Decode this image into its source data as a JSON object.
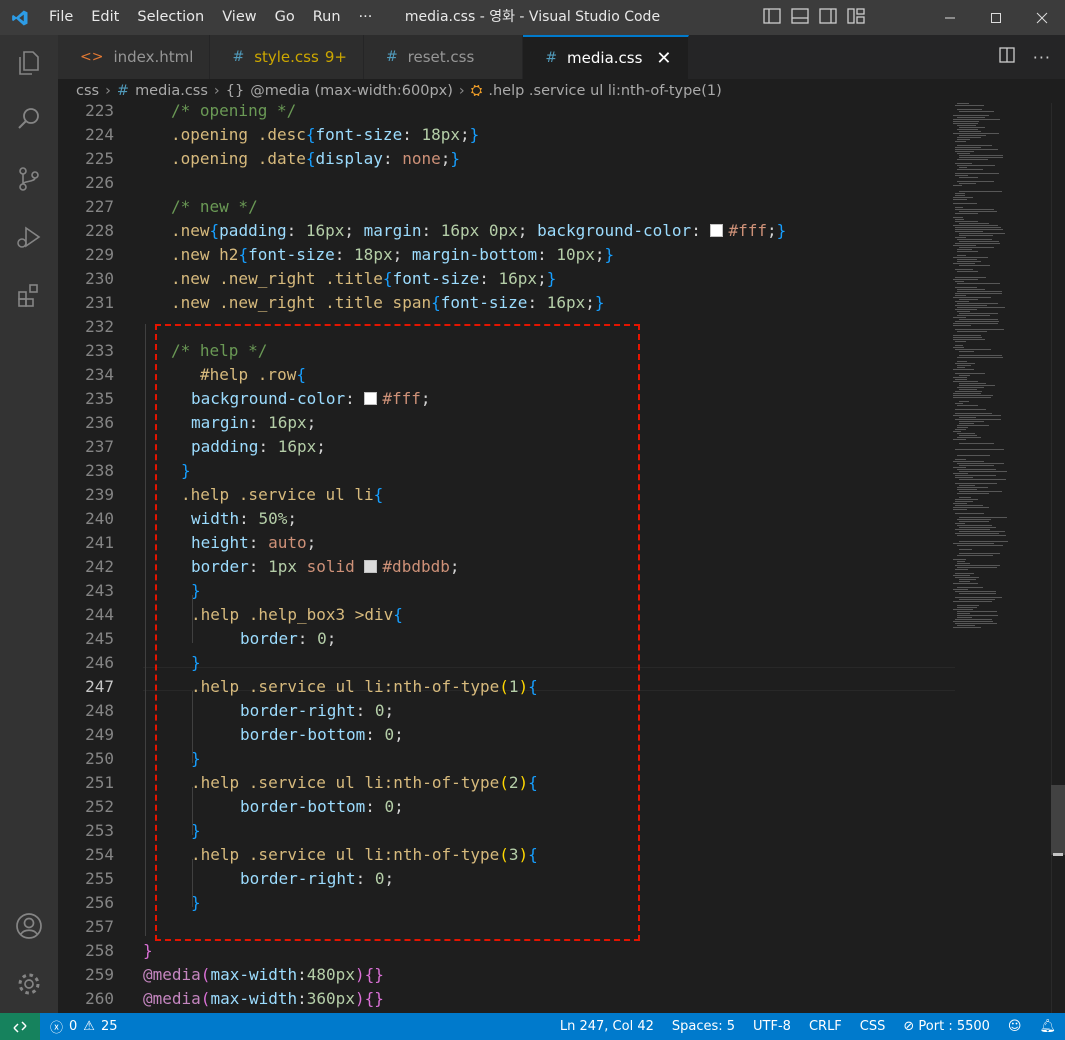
{
  "titlebar": {
    "menu": [
      "File",
      "Edit",
      "Selection",
      "View",
      "Go",
      "Run",
      "···"
    ],
    "title": "media.css - 영화 - Visual Studio Code",
    "accent_color": "#007acc"
  },
  "activitybar": {
    "icons": [
      "explorer-icon",
      "search-icon",
      "source-control-icon",
      "run-debug-icon",
      "extensions-icon",
      "account-icon",
      "settings-gear-icon"
    ]
  },
  "tabs": [
    {
      "icon": "<>",
      "label": "index.html",
      "badge": ""
    },
    {
      "icon": "#",
      "label": "style.css",
      "badge": "9+"
    },
    {
      "icon": "#",
      "label": "reset.css",
      "badge": ""
    },
    {
      "icon": "#",
      "label": "media.css",
      "badge": "",
      "active": true
    }
  ],
  "breadcrumb": {
    "folder": "css",
    "file": "media.css",
    "media": "@media (max-width:600px)",
    "selector": ".help .service ul li:nth-of-type(1)"
  },
  "editor": {
    "current_line": 247,
    "lines": [
      {
        "n": "223",
        "tokens": [
          [
            "t-cm",
            "/* opening */"
          ]
        ],
        "indent": 28
      },
      {
        "n": "224",
        "tokens": [
          [
            "t-sel",
            ".opening .desc"
          ],
          [
            "t-b3",
            "{"
          ],
          [
            "t-prop",
            "font-size"
          ],
          [
            "t-pun",
            ": "
          ],
          [
            "t-num",
            "18px"
          ],
          [
            "t-pun",
            ";"
          ],
          [
            "t-b3",
            "}"
          ]
        ],
        "indent": 28
      },
      {
        "n": "225",
        "tokens": [
          [
            "t-sel",
            ".opening .date"
          ],
          [
            "t-b3",
            "{"
          ],
          [
            "t-prop",
            "display"
          ],
          [
            "t-pun",
            ": "
          ],
          [
            "t-val",
            "none"
          ],
          [
            "t-pun",
            ";"
          ],
          [
            "t-b3",
            "}"
          ]
        ],
        "indent": 28
      },
      {
        "n": "226",
        "tokens": [],
        "indent": 0
      },
      {
        "n": "227",
        "tokens": [
          [
            "t-cm",
            "/* new */"
          ]
        ],
        "indent": 28
      },
      {
        "n": "228",
        "tokens": [
          [
            "t-sel",
            ".new"
          ],
          [
            "t-b3",
            "{"
          ],
          [
            "t-prop",
            "padding"
          ],
          [
            "t-pun",
            ": "
          ],
          [
            "t-num",
            "16px"
          ],
          [
            "t-pun",
            "; "
          ],
          [
            "t-prop",
            "margin"
          ],
          [
            "t-pun",
            ": "
          ],
          [
            "t-num",
            "16px 0px"
          ],
          [
            "t-pun",
            "; "
          ],
          [
            "t-prop",
            "background-color"
          ],
          [
            "t-pun",
            ": "
          ],
          [
            "swatch",
            "#ffffff"
          ],
          [
            "t-val",
            "#fff"
          ],
          [
            "t-pun",
            ";"
          ],
          [
            "t-b3",
            "}"
          ]
        ],
        "indent": 28
      },
      {
        "n": "229",
        "tokens": [
          [
            "t-sel",
            ".new h2"
          ],
          [
            "t-b3",
            "{"
          ],
          [
            "t-prop",
            "font-size"
          ],
          [
            "t-pun",
            ": "
          ],
          [
            "t-num",
            "18px"
          ],
          [
            "t-pun",
            "; "
          ],
          [
            "t-prop",
            "margin-bottom"
          ],
          [
            "t-pun",
            ": "
          ],
          [
            "t-num",
            "10px"
          ],
          [
            "t-pun",
            ";"
          ],
          [
            "t-b3",
            "}"
          ]
        ],
        "indent": 28
      },
      {
        "n": "230",
        "tokens": [
          [
            "t-sel",
            ".new .new_right .title"
          ],
          [
            "t-b3",
            "{"
          ],
          [
            "t-prop",
            "font-size"
          ],
          [
            "t-pun",
            ": "
          ],
          [
            "t-num",
            "16px"
          ],
          [
            "t-pun",
            ";"
          ],
          [
            "t-b3",
            "}"
          ]
        ],
        "indent": 28
      },
      {
        "n": "231",
        "tokens": [
          [
            "t-sel",
            ".new .new_right .title span"
          ],
          [
            "t-b3",
            "{"
          ],
          [
            "t-prop",
            "font-size"
          ],
          [
            "t-pun",
            ": "
          ],
          [
            "t-num",
            "16px"
          ],
          [
            "t-pun",
            ";"
          ],
          [
            "t-b3",
            "}"
          ]
        ],
        "indent": 28
      },
      {
        "n": "232",
        "tokens": [],
        "indent": 0
      },
      {
        "n": "233",
        "tokens": [
          [
            "t-cm",
            "/* help */"
          ]
        ],
        "indent": 28
      },
      {
        "n": "234",
        "tokens": [
          [
            "t-sel",
            "#help .row"
          ],
          [
            "t-b3",
            "{"
          ]
        ],
        "indent": 57
      },
      {
        "n": "235",
        "tokens": [
          [
            "t-prop",
            "background-color"
          ],
          [
            "t-pun",
            ": "
          ],
          [
            "swatch",
            "#ffffff"
          ],
          [
            "t-val",
            "#fff"
          ],
          [
            "t-pun",
            ";"
          ]
        ],
        "indent": 48
      },
      {
        "n": "236",
        "tokens": [
          [
            "t-prop",
            "margin"
          ],
          [
            "t-pun",
            ": "
          ],
          [
            "t-num",
            "16px"
          ],
          [
            "t-pun",
            ";"
          ]
        ],
        "indent": 48
      },
      {
        "n": "237",
        "tokens": [
          [
            "t-prop",
            "padding"
          ],
          [
            "t-pun",
            ": "
          ],
          [
            "t-num",
            "16px"
          ],
          [
            "t-pun",
            ";"
          ]
        ],
        "indent": 48
      },
      {
        "n": "238",
        "tokens": [
          [
            "t-b3",
            "}"
          ]
        ],
        "indent": 38
      },
      {
        "n": "239",
        "tokens": [
          [
            "t-sel",
            ".help .service ul li"
          ],
          [
            "t-b3",
            "{"
          ]
        ],
        "indent": 38
      },
      {
        "n": "240",
        "tokens": [
          [
            "t-prop",
            "width"
          ],
          [
            "t-pun",
            ": "
          ],
          [
            "t-num",
            "50%"
          ],
          [
            "t-pun",
            ";"
          ]
        ],
        "indent": 48
      },
      {
        "n": "241",
        "tokens": [
          [
            "t-prop",
            "height"
          ],
          [
            "t-pun",
            ": "
          ],
          [
            "t-val",
            "auto"
          ],
          [
            "t-pun",
            ";"
          ]
        ],
        "indent": 48
      },
      {
        "n": "242",
        "tokens": [
          [
            "t-prop",
            "border"
          ],
          [
            "t-pun",
            ": "
          ],
          [
            "t-num",
            "1px"
          ],
          [
            "t-pun",
            " "
          ],
          [
            "t-val",
            "solid"
          ],
          [
            "t-pun",
            " "
          ],
          [
            "swatch",
            "#dbdbdb"
          ],
          [
            "t-val",
            "#dbdbdb"
          ],
          [
            "t-pun",
            ";"
          ]
        ],
        "indent": 48
      },
      {
        "n": "243",
        "tokens": [
          [
            "t-b3",
            "}"
          ]
        ],
        "indent": 48
      },
      {
        "n": "244",
        "tokens": [
          [
            "t-sel",
            ".help .help_box3 >div"
          ],
          [
            "t-b3",
            "{"
          ]
        ],
        "indent": 48
      },
      {
        "n": "245",
        "tokens": [
          [
            "t-prop",
            "border"
          ],
          [
            "t-pun",
            ": "
          ],
          [
            "t-num",
            "0"
          ],
          [
            "t-pun",
            ";"
          ]
        ],
        "indent": 97
      },
      {
        "n": "246",
        "tokens": [
          [
            "t-b3",
            "}"
          ]
        ],
        "indent": 48
      },
      {
        "n": "247",
        "tokens": [
          [
            "t-sel",
            ".help .service ul li:nth-of-type"
          ],
          [
            "t-b2",
            "("
          ],
          [
            "t-num",
            "1"
          ],
          [
            "t-b2",
            ")"
          ],
          [
            "t-b3",
            "{"
          ]
        ],
        "indent": 48
      },
      {
        "n": "248",
        "tokens": [
          [
            "t-prop",
            "border-right"
          ],
          [
            "t-pun",
            ": "
          ],
          [
            "t-num",
            "0"
          ],
          [
            "t-pun",
            ";"
          ]
        ],
        "indent": 97
      },
      {
        "n": "249",
        "tokens": [
          [
            "t-prop",
            "border-bottom"
          ],
          [
            "t-pun",
            ": "
          ],
          [
            "t-num",
            "0"
          ],
          [
            "t-pun",
            ";"
          ]
        ],
        "indent": 97
      },
      {
        "n": "250",
        "tokens": [
          [
            "t-b3",
            "}"
          ]
        ],
        "indent": 48
      },
      {
        "n": "251",
        "tokens": [
          [
            "t-sel",
            ".help .service ul li:nth-of-type"
          ],
          [
            "t-b2",
            "("
          ],
          [
            "t-num",
            "2"
          ],
          [
            "t-b2",
            ")"
          ],
          [
            "t-b3",
            "{"
          ]
        ],
        "indent": 48
      },
      {
        "n": "252",
        "tokens": [
          [
            "t-prop",
            "border-bottom"
          ],
          [
            "t-pun",
            ": "
          ],
          [
            "t-num",
            "0"
          ],
          [
            "t-pun",
            ";"
          ]
        ],
        "indent": 97
      },
      {
        "n": "253",
        "tokens": [
          [
            "t-b3",
            "}"
          ]
        ],
        "indent": 48
      },
      {
        "n": "254",
        "tokens": [
          [
            "t-sel",
            ".help .service ul li:nth-of-type"
          ],
          [
            "t-b2",
            "("
          ],
          [
            "t-num",
            "3"
          ],
          [
            "t-b2",
            ")"
          ],
          [
            "t-b3",
            "{"
          ]
        ],
        "indent": 48
      },
      {
        "n": "255",
        "tokens": [
          [
            "t-prop",
            "border-right"
          ],
          [
            "t-pun",
            ": "
          ],
          [
            "t-num",
            "0"
          ],
          [
            "t-pun",
            ";"
          ]
        ],
        "indent": 97
      },
      {
        "n": "256",
        "tokens": [
          [
            "t-b3",
            "}"
          ]
        ],
        "indent": 48
      },
      {
        "n": "257",
        "tokens": [],
        "indent": 0
      },
      {
        "n": "258",
        "tokens": [
          [
            "t-b1",
            "}"
          ]
        ],
        "indent": 0
      },
      {
        "n": "259",
        "tokens": [
          [
            "t-at",
            "@media"
          ],
          [
            "t-b1",
            "("
          ],
          [
            "t-prop",
            "max-width"
          ],
          [
            "t-pun",
            ":"
          ],
          [
            "t-num",
            "480px"
          ],
          [
            "t-b1",
            ")"
          ],
          [
            "t-b1",
            "{}"
          ]
        ],
        "indent": 0
      },
      {
        "n": "260",
        "tokens": [
          [
            "t-at",
            "@media"
          ],
          [
            "t-b1",
            "("
          ],
          [
            "t-prop",
            "max-width"
          ],
          [
            "t-pun",
            ":"
          ],
          [
            "t-num",
            "360px"
          ],
          [
            "t-b1",
            ")"
          ],
          [
            "t-b1",
            "{}"
          ]
        ],
        "indent": 0
      }
    ]
  },
  "statusbar": {
    "errors": "0",
    "warnings": "25",
    "position": "Ln 247, Col 42",
    "spaces": "Spaces: 5",
    "encoding": "UTF-8",
    "eol": "CRLF",
    "language": "CSS",
    "port": "Port : 5500"
  }
}
